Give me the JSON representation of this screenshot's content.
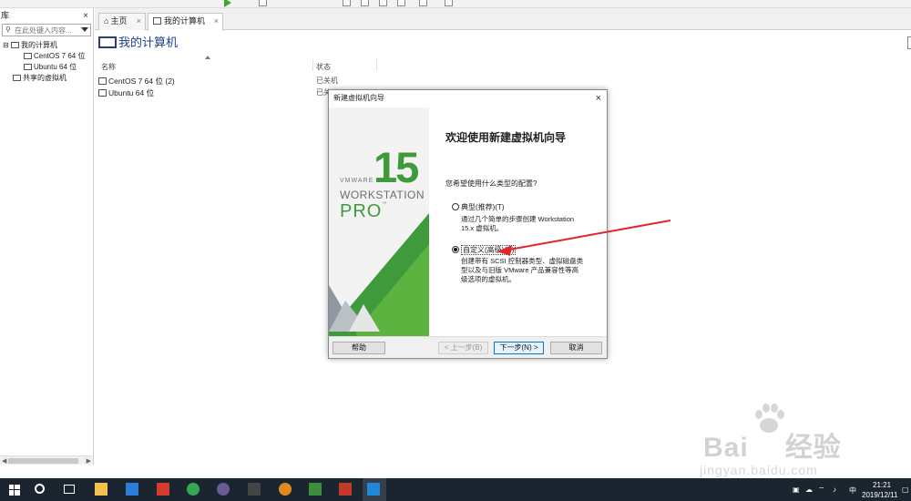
{
  "library": {
    "title": "库",
    "close": "×",
    "search_placeholder": "在此处键入内容...",
    "tree": [
      {
        "label": "我的计算机",
        "expander": "⊟"
      },
      {
        "label": "CentOS 7 64 位"
      },
      {
        "label": "Ubuntu 64 位"
      },
      {
        "label": "共享的虚拟机"
      }
    ]
  },
  "tabs": [
    {
      "label": "主页",
      "close": "×"
    },
    {
      "label": "我的计算机",
      "close": "×"
    }
  ],
  "main": {
    "title": "我的计算机",
    "col_name": "名称",
    "col_state": "状态",
    "vms": [
      {
        "name": "CentOS 7 64 位 (2)",
        "state": "已关机"
      },
      {
        "name": "Ubuntu 64 位",
        "state": "已关"
      }
    ]
  },
  "dialog": {
    "title": "新建虚拟机向导",
    "close": "×",
    "brand": {
      "number": "15",
      "vmware": "VMWARE",
      "workstation": "WORKSTATION",
      "pro": "PRO",
      "tm": "™"
    },
    "heading": "欢迎使用新建虚拟机向导",
    "question": "您希望使用什么类型的配置?",
    "options": [
      {
        "label": "典型(推荐)(T)",
        "selected": false,
        "desc": [
          "通过几个简单的步骤创建 Workstation",
          "15.x 虚拟机。"
        ]
      },
      {
        "label": "自定义(高级)(C)",
        "selected": true,
        "desc": [
          "创建带有 SCSI 控制器类型、虚拟磁盘类",
          "型以及与旧版 VMware 产品兼容性等高",
          "级选项的虚拟机。"
        ]
      }
    ],
    "buttons": {
      "help": "帮助",
      "back": "< 上一步(B)",
      "next": "下一步(N) >",
      "cancel": "取消"
    }
  },
  "taskbar": {
    "time": "21:21",
    "date": "2019/12/11",
    "ime": "中",
    "app_colors": [
      "#f2c14e",
      "#2d7cd6",
      "#d63a2f",
      "#34a853",
      "#6b5b95",
      "#444444",
      "#e08a1e",
      "#3c8d3c",
      "#c0392b",
      "#0078d7"
    ]
  },
  "watermark": {
    "brand": "Bai",
    "brand2": "经验",
    "url": "jingyan.baidu.com"
  }
}
